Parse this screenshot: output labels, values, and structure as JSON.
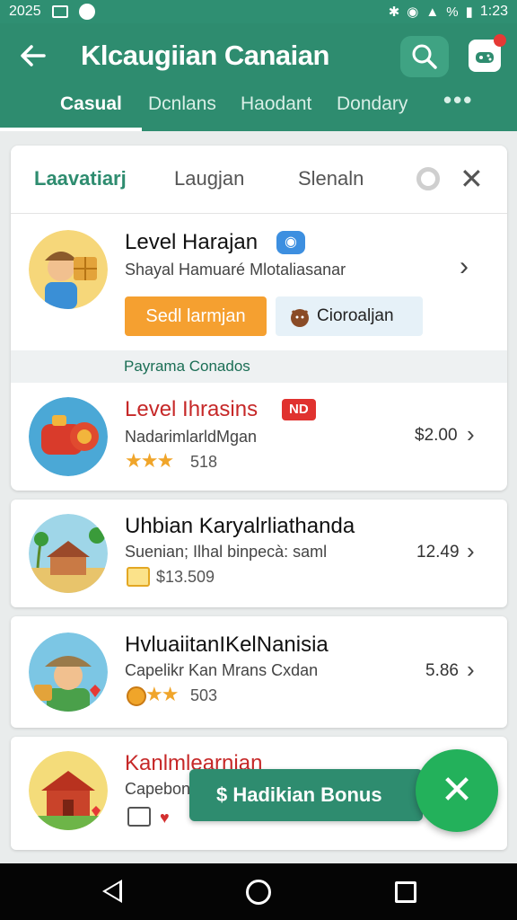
{
  "status_bar": {
    "time_left": "2025",
    "time_right": "1:23",
    "battery": "%"
  },
  "app_bar": {
    "title": "Klcaugiian Canaian"
  },
  "tabs": [
    {
      "label": "Casual",
      "active": true
    },
    {
      "label": "Dcnlans"
    },
    {
      "label": "Haodant"
    },
    {
      "label": "Dondary"
    },
    {
      "label": "•••"
    }
  ],
  "panel": {
    "subtabs": [
      {
        "label": "Laavatiarj",
        "active": true
      },
      {
        "label": "Laugjan"
      },
      {
        "label": "Slenaln"
      }
    ],
    "featured": {
      "title": "Level Harajan",
      "subtitle": "Shayal Hamuaré Mlotaliasanar",
      "primary_button": "Sedl larmjan",
      "secondary_button": "Cioroaljan"
    },
    "section_label": "Payrama Conados"
  },
  "list": [
    {
      "title": "Level Ihrasins",
      "badge": "ND",
      "subtitle": "NadarimlarldMgan",
      "stars": "★★★",
      "count": "518",
      "price": "$2.00"
    },
    {
      "title": "Uhbian Karyalrliathanda",
      "subtitle": "Suenian; Ilhal binpecà: saml",
      "count": "$13.509",
      "price": "12.49"
    },
    {
      "title": "HvluaiitanIKelNanisia",
      "subtitle": "Capelikr Kan Mrans Cxdan",
      "stars": "★★",
      "count": "503",
      "price": "5.86"
    },
    {
      "title": "Kanlmlearnian",
      "subtitle": "Capebon"
    }
  ],
  "snackbar": {
    "label": "$ Hadikian Bonus"
  },
  "fab": {
    "icon": "close-icon",
    "glyph": "✕"
  },
  "colors": {
    "primary": "#2e8c6f",
    "accent_orange": "#f5a030",
    "fab": "#23b15b",
    "badge": "#e0322f"
  }
}
